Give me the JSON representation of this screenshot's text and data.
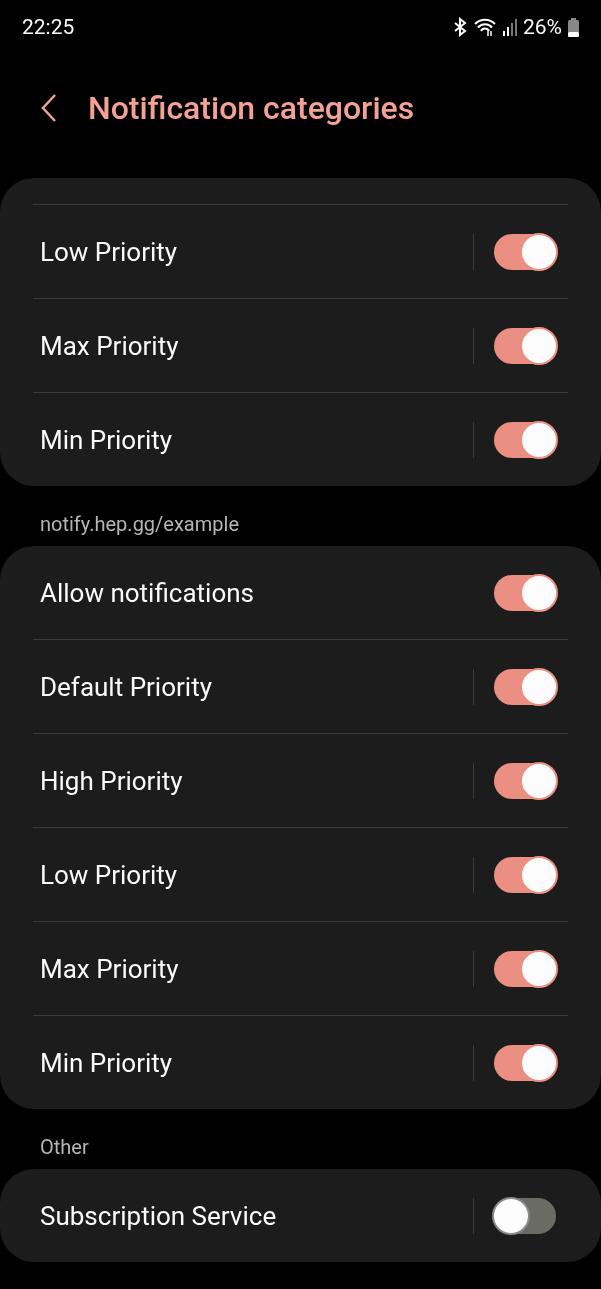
{
  "status_bar": {
    "time": "22:25",
    "battery": "26%"
  },
  "header": {
    "title": "Notification categories"
  },
  "sections": [
    {
      "scrolled_top": true,
      "rows": [
        {
          "label": "Low Priority",
          "kind": "split",
          "on": true
        },
        {
          "label": "Max Priority",
          "kind": "split",
          "on": true
        },
        {
          "label": "Min Priority",
          "kind": "split",
          "on": true
        }
      ]
    },
    {
      "label": "notify.hep.gg/example",
      "rows": [
        {
          "label": "Allow notifications",
          "kind": "plain",
          "on": true
        },
        {
          "label": "Default Priority",
          "kind": "split",
          "on": true
        },
        {
          "label": "High Priority",
          "kind": "split",
          "on": true
        },
        {
          "label": "Low Priority",
          "kind": "split",
          "on": true
        },
        {
          "label": "Max Priority",
          "kind": "split",
          "on": true
        },
        {
          "label": "Min Priority",
          "kind": "split",
          "on": true
        }
      ]
    },
    {
      "label": "Other",
      "rows": [
        {
          "label": "Subscription Service",
          "kind": "split",
          "on": false
        }
      ]
    }
  ]
}
